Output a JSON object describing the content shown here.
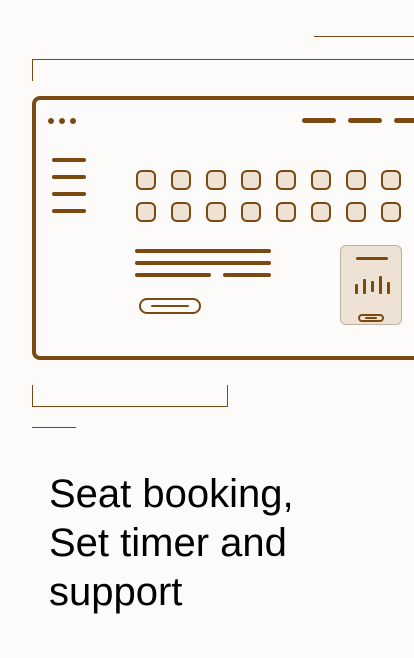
{
  "illustration": {
    "icons": {
      "window": "browser-window-icon",
      "menu": "hamburger-menu-icon",
      "seats": "seat-grid-icon",
      "timer": "timer-card-icon"
    },
    "colors": {
      "stroke": "#7a4a12",
      "seat_fill": "#ede2d4",
      "background": "#fcfbf9",
      "text": "#000000"
    }
  },
  "headline": {
    "lines": [
      "Seat booking,",
      "Set timer and",
      "support"
    ]
  }
}
